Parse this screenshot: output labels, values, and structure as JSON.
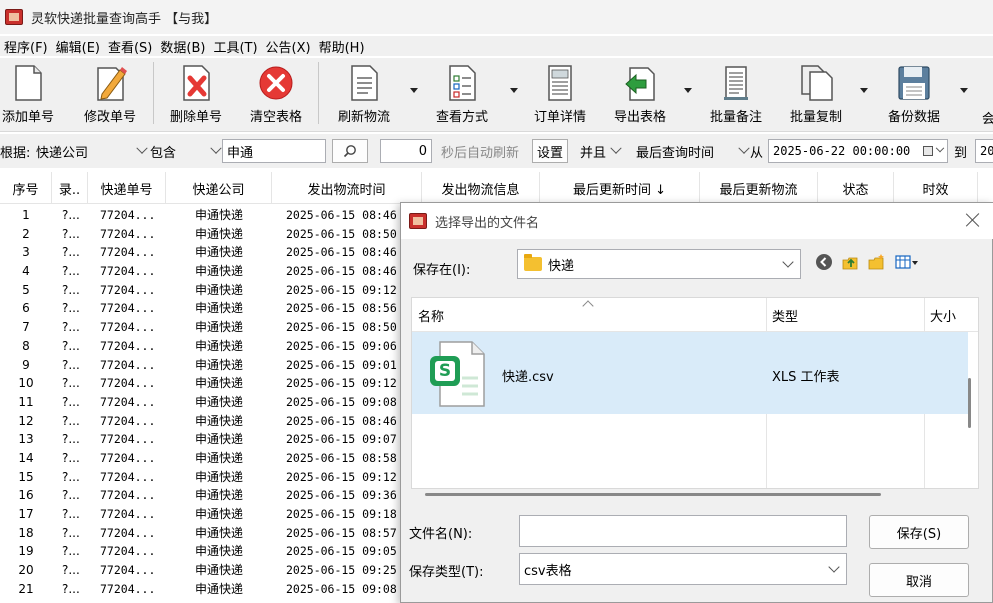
{
  "app": {
    "title": "灵软快递批量查询高手 【与我】"
  },
  "menu": [
    "程序(F)",
    "编辑(E)",
    "查看(S)",
    "数据(B)",
    "工具(T)",
    "公告(X)",
    "帮助(H)"
  ],
  "toolbar": {
    "add": "添加单号",
    "edit": "修改单号",
    "delete": "删除单号",
    "clear": "清空表格",
    "refresh": "刷新物流",
    "view": "查看方式",
    "detail": "订单详情",
    "export": "导出表格",
    "note": "批量备注",
    "copy": "批量复制",
    "backup": "备份数据",
    "more": "会"
  },
  "filter": {
    "by_label": "根据:",
    "field": "快递公司",
    "op": "包含",
    "value": "申通",
    "seconds": "0",
    "auto_refresh": "秒后自动刷新",
    "settings": "设置",
    "logic": "并且",
    "time_field": "最后查询时间",
    "from_label": "从",
    "from_date": "2025-06-22 00:00:00",
    "to_label": "到",
    "to_date_partial": "20"
  },
  "table": {
    "columns": [
      "序号",
      "录..",
      "快递单号",
      "快递公司",
      "发出物流时间",
      "发出物流信息",
      "最后更新时间 ↓",
      "最后更新物流",
      "状态",
      "时效"
    ],
    "rows": [
      {
        "seq": "1",
        "flag": "?...",
        "no": "77204...",
        "company": "申通快递",
        "time": "2025-06-15 08:46"
      },
      {
        "seq": "2",
        "flag": "?...",
        "no": "77204...",
        "company": "申通快递",
        "time": "2025-06-15 08:50"
      },
      {
        "seq": "3",
        "flag": "?...",
        "no": "77204...",
        "company": "申通快递",
        "time": "2025-06-15 08:46"
      },
      {
        "seq": "4",
        "flag": "?...",
        "no": "77204...",
        "company": "申通快递",
        "time": "2025-06-15 08:46"
      },
      {
        "seq": "5",
        "flag": "?...",
        "no": "77204...",
        "company": "申通快递",
        "time": "2025-06-15 09:12"
      },
      {
        "seq": "6",
        "flag": "?...",
        "no": "77204...",
        "company": "申通快递",
        "time": "2025-06-15 08:56"
      },
      {
        "seq": "7",
        "flag": "?...",
        "no": "77204...",
        "company": "申通快递",
        "time": "2025-06-15 08:50"
      },
      {
        "seq": "8",
        "flag": "?...",
        "no": "77204...",
        "company": "申通快递",
        "time": "2025-06-15 09:06"
      },
      {
        "seq": "9",
        "flag": "?...",
        "no": "77204...",
        "company": "申通快递",
        "time": "2025-06-15 09:01"
      },
      {
        "seq": "10",
        "flag": "?...",
        "no": "77204...",
        "company": "申通快递",
        "time": "2025-06-15 09:12"
      },
      {
        "seq": "11",
        "flag": "?...",
        "no": "77204...",
        "company": "申通快递",
        "time": "2025-06-15 09:08"
      },
      {
        "seq": "12",
        "flag": "?...",
        "no": "77204...",
        "company": "申通快递",
        "time": "2025-06-15 08:46"
      },
      {
        "seq": "13",
        "flag": "?...",
        "no": "77204...",
        "company": "申通快递",
        "time": "2025-06-15 09:07"
      },
      {
        "seq": "14",
        "flag": "?...",
        "no": "77204...",
        "company": "申通快递",
        "time": "2025-06-15 08:58"
      },
      {
        "seq": "15",
        "flag": "?...",
        "no": "77204...",
        "company": "申通快递",
        "time": "2025-06-15 09:12"
      },
      {
        "seq": "16",
        "flag": "?...",
        "no": "77204...",
        "company": "申通快递",
        "time": "2025-06-15 09:36"
      },
      {
        "seq": "17",
        "flag": "?...",
        "no": "77204...",
        "company": "申通快递",
        "time": "2025-06-15 09:18"
      },
      {
        "seq": "18",
        "flag": "?...",
        "no": "77204...",
        "company": "申通快递",
        "time": "2025-06-15 08:57"
      },
      {
        "seq": "19",
        "flag": "?...",
        "no": "77204...",
        "company": "申通快递",
        "time": "2025-06-15 09:05"
      },
      {
        "seq": "20",
        "flag": "?...",
        "no": "77204...",
        "company": "申通快递",
        "time": "2025-06-15 09:25"
      },
      {
        "seq": "21",
        "flag": "?...",
        "no": "77204...",
        "company": "申通快递",
        "time": "2025-06-15 09:08"
      }
    ]
  },
  "dialog": {
    "title": "选择导出的文件名",
    "save_in_label": "保存在(I):",
    "save_in_value": "快递",
    "col_name": "名称",
    "col_type": "类型",
    "col_size": "大小",
    "file_name": "快递.csv",
    "file_type": "XLS 工作表",
    "file_badge": "S",
    "filename_label": "文件名(N):",
    "filename_value": "",
    "filetype_label": "保存类型(T):",
    "filetype_value": "csv表格",
    "save_btn": "保存(S)",
    "cancel_btn": "取消"
  },
  "colors": {
    "selection": "#d9ebf9",
    "accent": "#1f9d55",
    "delete_red": "#e53935"
  }
}
